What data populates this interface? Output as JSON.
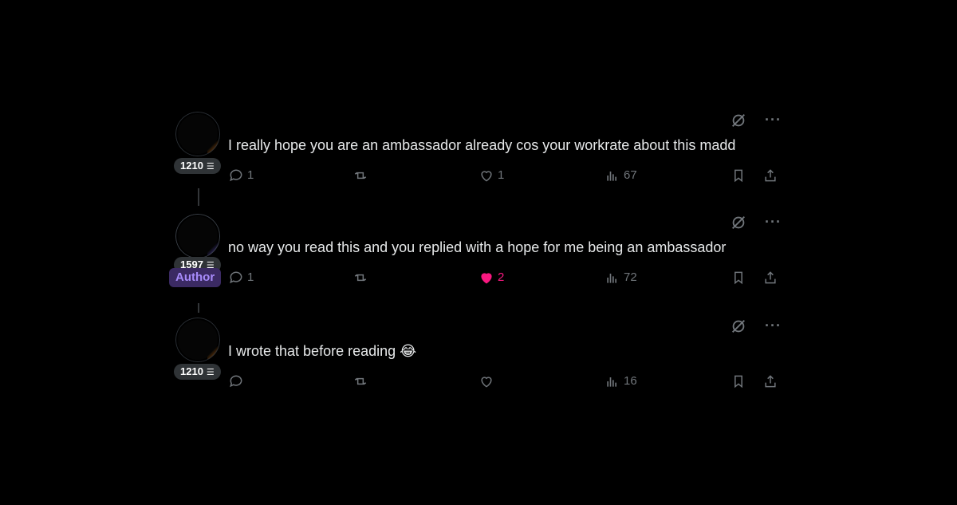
{
  "posts": [
    {
      "badge": "1210",
      "text": "I really hope you are an ambassador already cos your workrate about this madd",
      "reply_count": "1",
      "repost_count": "",
      "like_count": "1",
      "view_count": "67",
      "liked": false,
      "avatar_glow": "#d97a1f"
    },
    {
      "badge": "1597",
      "author_tag": "Author",
      "text": "no way you read this and you replied with a hope for me being an ambassador",
      "reply_count": "1",
      "repost_count": "",
      "like_count": "2",
      "view_count": "72",
      "liked": true,
      "avatar_glow": "#6d5bd0"
    },
    {
      "badge": "1210",
      "text": "I wrote that before reading 😂",
      "reply_count": "",
      "repost_count": "",
      "like_count": "",
      "view_count": "16",
      "liked": false,
      "avatar_glow": "#d97a1f"
    }
  ],
  "icons": {
    "reply": "reply-icon",
    "repost": "repost-icon",
    "like": "heart-icon",
    "views": "views-icon",
    "bookmark": "bookmark-icon",
    "share": "share-icon",
    "grok": "grok-icon",
    "more": "more-icon"
  },
  "colors": {
    "background": "#000000",
    "text": "#e7e9ea",
    "muted": "#71767b",
    "like_active": "#f91880",
    "author_tag_bg": "#3b2a63",
    "author_tag_text": "#a78bfa"
  }
}
